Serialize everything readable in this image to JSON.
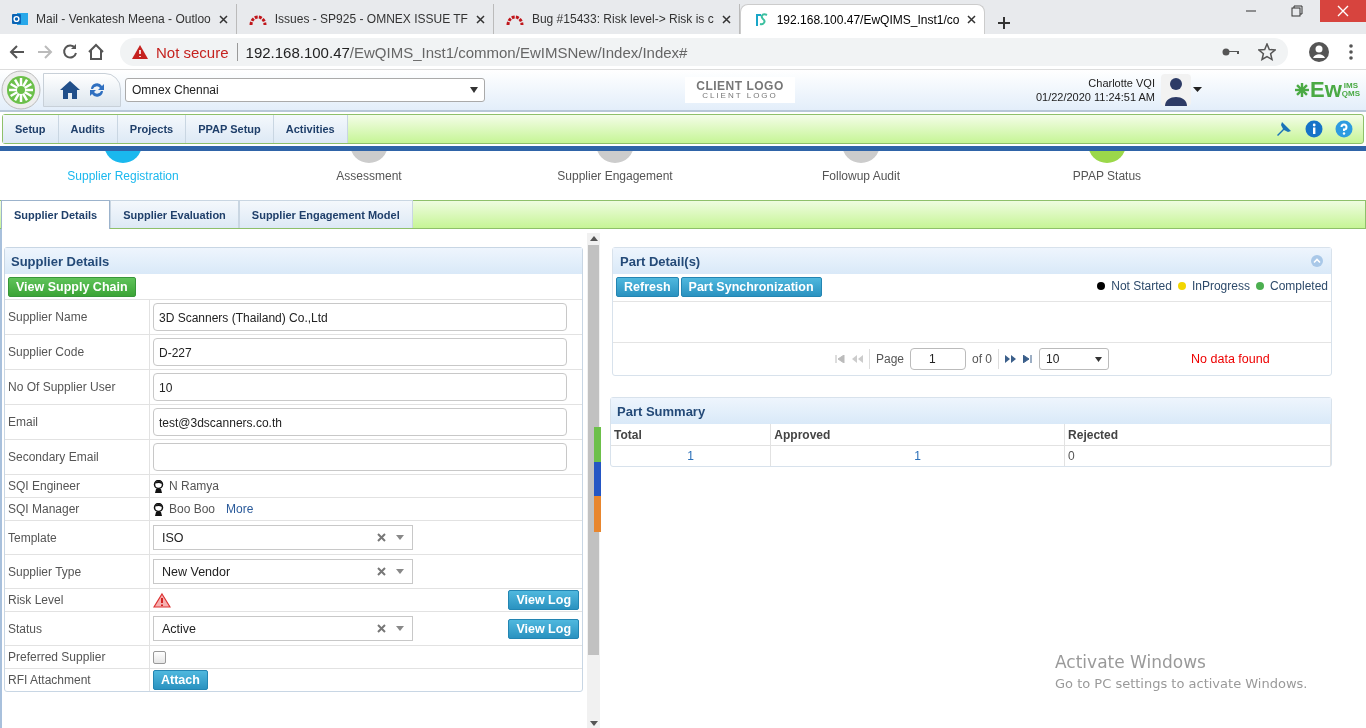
{
  "browser": {
    "tabs": [
      {
        "kind": "outlook",
        "title": "Mail - Venkatesh Meena - Outloo",
        "selected": false
      },
      {
        "kind": "tracker",
        "title": "Issues - SP925 - OMNEX ISSUE TF",
        "selected": false
      },
      {
        "kind": "tracker",
        "title": "Bug #15433: Risk level-> Risk is c",
        "selected": false
      },
      {
        "kind": "app",
        "title": "192.168.100.47/EwQIMS_Inst1/co",
        "selected": true
      }
    ],
    "security": "Not secure",
    "host": "192.168.100.47",
    "path": "/EwQIMS_Inst1/common/EwIMSNew/Index/Index#"
  },
  "header": {
    "company": "Omnex Chennai",
    "client_logo": "CLIENT LOGO",
    "client_logo_sub": "CLIENT LOGO",
    "user": "Charlotte VQI",
    "datetime": "01/22/2020 11:24:51 AM",
    "brand": "Ew",
    "brand_sup": "IMS",
    "brand_sub": "QMS"
  },
  "menu": [
    "Setup",
    "Audits",
    "Projects",
    "PPAP Setup",
    "Activities"
  ],
  "steps": [
    {
      "label": "Supplier Registration",
      "selected": true
    },
    {
      "label": "Assessment",
      "selected": false
    },
    {
      "label": "Supplier Engagement",
      "selected": false
    },
    {
      "label": "Followup Audit",
      "selected": false
    },
    {
      "label": "PPAP Status",
      "selected": false
    }
  ],
  "subtabs": [
    {
      "label": "Supplier Details",
      "selected": true
    },
    {
      "label": "Supplier Evaluation",
      "selected": false
    },
    {
      "label": "Supplier Engagement Model",
      "selected": false
    }
  ],
  "supplier_details": {
    "title": "Supplier Details",
    "chain_button": "View Supply Chain",
    "fields": [
      {
        "kind": "input",
        "label": "Supplier Name",
        "value": "3D Scanners (Thailand) Co.,Ltd"
      },
      {
        "kind": "input",
        "label": "Supplier Code",
        "value": "D-227"
      },
      {
        "kind": "input",
        "label": "No Of Supplier User",
        "value": "10"
      },
      {
        "kind": "input",
        "label": "Email",
        "value": "test@3dscanners.co.th"
      },
      {
        "kind": "input",
        "label": "Secondary Email"
      },
      {
        "kind": "person",
        "label": "SQI Engineer",
        "value": "N Ramya"
      },
      {
        "kind": "person",
        "label": "SQI Manager",
        "value": "Boo Boo",
        "link": "More"
      },
      {
        "kind": "select",
        "label": "Template",
        "value": "ISO"
      },
      {
        "kind": "select",
        "label": "Supplier Type",
        "value": "New Vendor"
      },
      {
        "kind": "risk",
        "label": "Risk Level",
        "action": "View Log"
      },
      {
        "kind": "select",
        "label": "Status",
        "value": "Active",
        "action": "View Log"
      },
      {
        "kind": "checkbox",
        "label": "Preferred Supplier",
        "checked": false
      },
      {
        "kind": "button",
        "label": "RFI Attachment",
        "action": "Attach"
      }
    ]
  },
  "part_details": {
    "title": "Part Detail(s)",
    "buttons": [
      "Refresh",
      "Part Synchronization"
    ],
    "legend": [
      {
        "label": "Not Started",
        "color": "#000000"
      },
      {
        "label": "InProgress",
        "color": "#f2d600"
      },
      {
        "label": "Completed",
        "color": "#4caf50"
      }
    ],
    "page_label": "Page",
    "page": "1",
    "page_of": "of 0",
    "page_size": "10",
    "message": "No data found"
  },
  "part_summary": {
    "title": "Part Summary",
    "columns": [
      "Total",
      "Approved",
      "Rejected"
    ],
    "rows": [
      [
        "1",
        "1",
        "0"
      ]
    ]
  },
  "os_notice": {
    "title": "Activate Windows",
    "text": "Go to PC settings to activate Windows."
  }
}
